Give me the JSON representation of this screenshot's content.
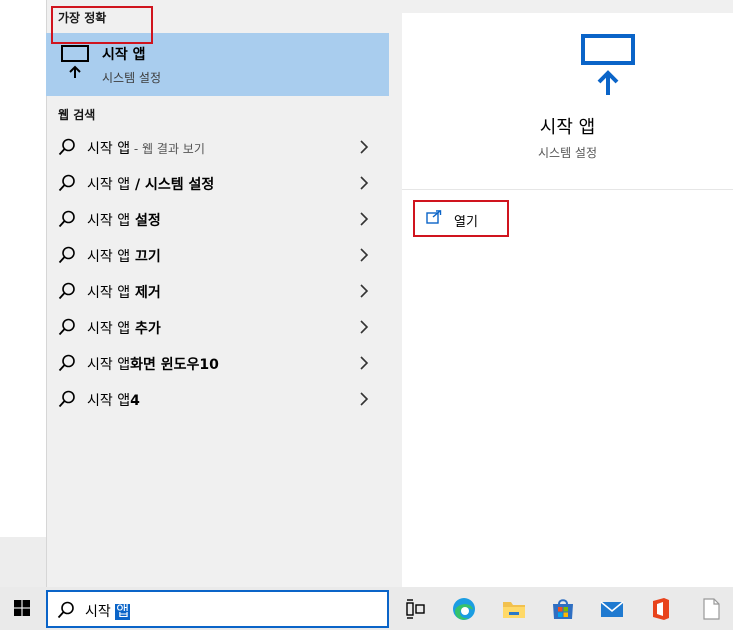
{
  "search_panel": {
    "best_match_header": "가장 정확",
    "best_match": {
      "title": "시작 앱",
      "subtitle": "시스템 설정",
      "icon": "monitor-icon"
    },
    "web_header": "웹 검색",
    "web_results": [
      {
        "query": "시작 앱",
        "bold": "",
        "suffix": " - 웹 결과 보기"
      },
      {
        "query": "시작 앱",
        "bold": " / 시스템 설정",
        "suffix": ""
      },
      {
        "query": "시작 앱",
        "bold": " 설정",
        "suffix": ""
      },
      {
        "query": "시작 앱",
        "bold": " 끄기",
        "suffix": ""
      },
      {
        "query": "시작 앱",
        "bold": " 제거",
        "suffix": ""
      },
      {
        "query": "시작 앱",
        "bold": " 추가",
        "suffix": ""
      },
      {
        "query": "시작 앱",
        "bold": "화면 윈도우10",
        "suffix": ""
      },
      {
        "query": "시작 앱",
        "bold": "4",
        "suffix": ""
      }
    ]
  },
  "detail": {
    "title": "시작 앱",
    "subtitle": "시스템 설정",
    "actions": [
      {
        "label": "열기",
        "icon": "open-icon"
      }
    ]
  },
  "taskbar": {
    "search_text": "시작 ",
    "search_selected": "앱",
    "apps": [
      "task-view-icon",
      "edge-icon",
      "file-explorer-icon",
      "store-icon",
      "mail-icon",
      "office-icon",
      "document-icon"
    ]
  },
  "colors": {
    "accent": "#0a64c8",
    "selection": "#a9cdee",
    "highlight_border": "#d0141e"
  }
}
